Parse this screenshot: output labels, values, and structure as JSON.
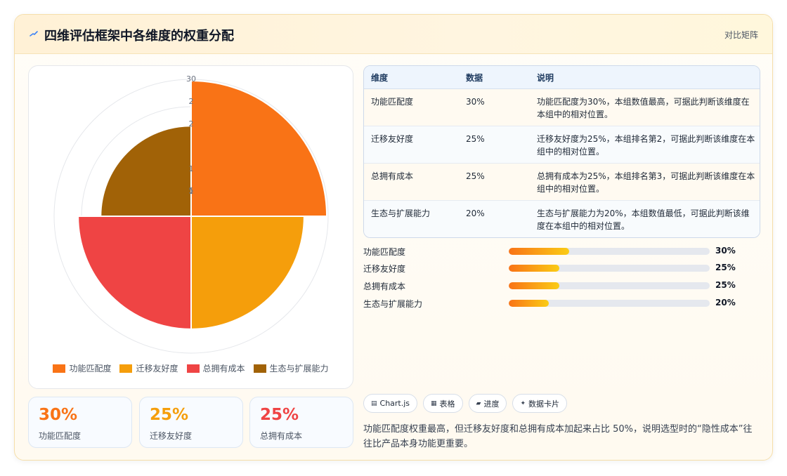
{
  "header": {
    "title": "四维评估框架中各维度的权重分配",
    "icon": "lightning-icon",
    "link": "对比矩阵"
  },
  "chart_data": {
    "type": "polarArea",
    "categories": [
      "功能匹配度",
      "迁移友好度",
      "总拥有成本",
      "生态与扩展能力"
    ],
    "values": [
      30,
      25,
      25,
      20
    ],
    "colors": [
      "#f97316",
      "#f59e0b",
      "#ef4444",
      "#a16207"
    ],
    "r_ticks": [
      "30",
      "2",
      "2",
      "1",
      "1",
      "5"
    ],
    "r_max": 30,
    "legend_position": "bottom"
  },
  "stats": [
    {
      "value": "30%",
      "label": "功能匹配度",
      "color": "#f97316"
    },
    {
      "value": "25%",
      "label": "迁移友好度",
      "color": "#f59e0b"
    },
    {
      "value": "25%",
      "label": "总拥有成本",
      "color": "#ef4444"
    }
  ],
  "table": {
    "headers": [
      "维度",
      "数据",
      "说明"
    ],
    "rows": [
      {
        "dim": "功能匹配度",
        "val": "30%",
        "desc": "功能匹配度为30%，本组数值最高，可据此判断该维度在本组中的相对位置。"
      },
      {
        "dim": "迁移友好度",
        "val": "25%",
        "desc": "迁移友好度为25%，本组排名第2，可据此判断该维度在本组中的相对位置。"
      },
      {
        "dim": "总拥有成本",
        "val": "25%",
        "desc": "总拥有成本为25%，本组排名第3，可据此判断该维度在本组中的相对位置。"
      },
      {
        "dim": "生态与扩展能力",
        "val": "20%",
        "desc": "生态与扩展能力为20%，本组数值最低，可据此判断该维度在本组中的相对位置。"
      }
    ]
  },
  "progress": [
    {
      "label": "功能匹配度",
      "value": "30%",
      "fraction": 0.3
    },
    {
      "label": "迁移友好度",
      "value": "25%",
      "fraction": 0.25
    },
    {
      "label": "总拥有成本",
      "value": "25%",
      "fraction": 0.25
    },
    {
      "label": "生态与扩展能力",
      "value": "20%",
      "fraction": 0.2
    }
  ],
  "tags": [
    {
      "icon": "chart-icon",
      "glyph": "▤",
      "label": "Chart.js"
    },
    {
      "icon": "table-icon",
      "glyph": "▦",
      "label": "表格"
    },
    {
      "icon": "progress-icon",
      "glyph": "▰",
      "label": "进度"
    },
    {
      "icon": "sparkle-icon",
      "glyph": "✦",
      "label": "数据卡片"
    }
  ],
  "note": "功能匹配度权重最高，但迁移友好度和总拥有成本加起来占比 50%，说明选型时的“隐性成本”往往比产品本身功能更重要。"
}
